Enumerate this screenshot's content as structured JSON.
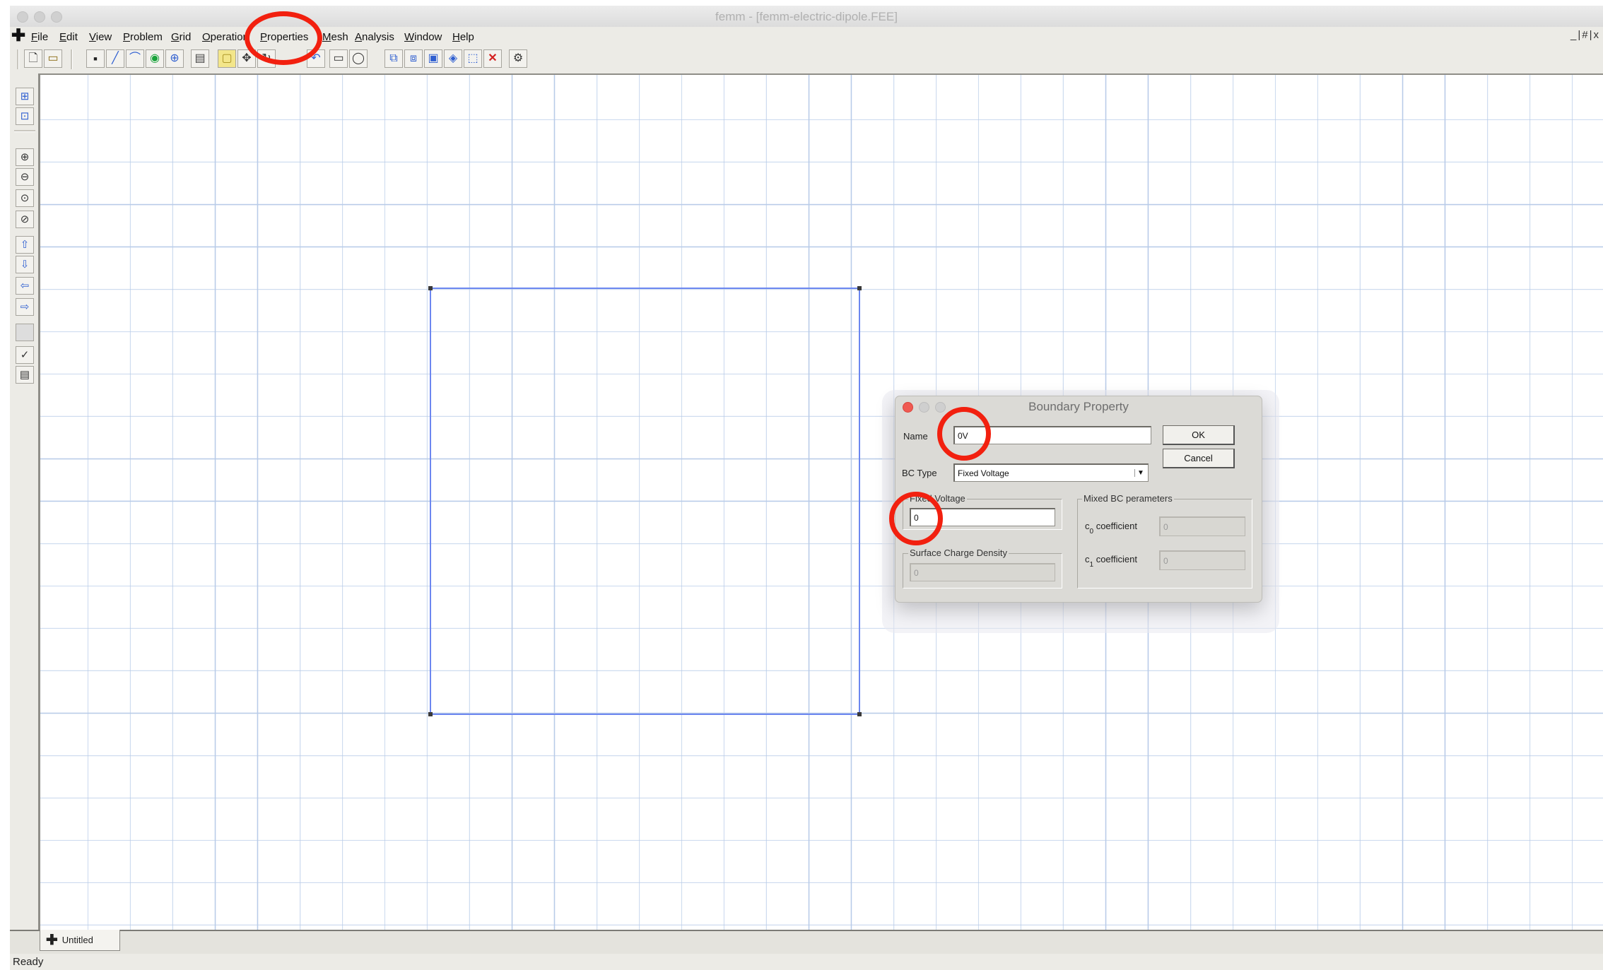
{
  "window": {
    "title": "femm - [femm-electric-dipole.FEE]"
  },
  "menubar": {
    "items": [
      "File",
      "Edit",
      "View",
      "Problem",
      "Grid",
      "Operation",
      "Properties",
      "Mesh",
      "Analysis",
      "Window",
      "Help"
    ],
    "window_controls": "_|#|x"
  },
  "toolbar": {
    "icons": [
      "new-file-icon",
      "open-file-icon",
      "node-mode-icon",
      "segment-mode-icon",
      "arc-mode-icon",
      "block-label-icon",
      "group-mode-icon",
      "properties-icon",
      "select-icon",
      "move-icon",
      "rotate-icon",
      "undo-icon",
      "rectangle-select-icon",
      "circle-select-icon",
      "copy-icon",
      "mirror-icon",
      "scale-icon",
      "fillet-icon",
      "open-boundary-icon",
      "delete-icon",
      "mesh-gear-icon"
    ]
  },
  "left_toolbar": {
    "icons": [
      "snap-grid-icon",
      "show-grid-icon",
      "zoom-in-icon",
      "zoom-out-icon",
      "zoom-natural-icon",
      "zoom-window-icon",
      "pan-up-icon",
      "pan-down-icon",
      "pan-left-icon",
      "pan-right-icon",
      "blank-icon",
      "run-analysis-icon",
      "view-results-icon"
    ]
  },
  "document_tab": {
    "label": "Untitled"
  },
  "status": {
    "text": "Ready"
  },
  "dialog": {
    "title": "Boundary Property",
    "name_label": "Name",
    "name_value": "0V",
    "bc_type_label": "BC Type",
    "bc_type_value": "Fixed Voltage",
    "ok_label": "OK",
    "cancel_label": "Cancel",
    "fixed_voltage_group": "Fixed Voltage",
    "fixed_voltage_value": "0",
    "surface_charge_group": "Surface Charge Density",
    "surface_charge_value": "0",
    "mixed_group": "Mixed BC perameters",
    "c0_label": "c",
    "c0_sub": "0",
    "c0_suffix": "coefficient",
    "c0_value": "0",
    "c1_label": "c",
    "c1_sub": "1",
    "c1_suffix": "coefficient",
    "c1_value": "0"
  },
  "colors": {
    "annotation_ring": "#f2200f",
    "geometry_line": "#6c87f0",
    "grid_line": "#b8cbe8"
  }
}
